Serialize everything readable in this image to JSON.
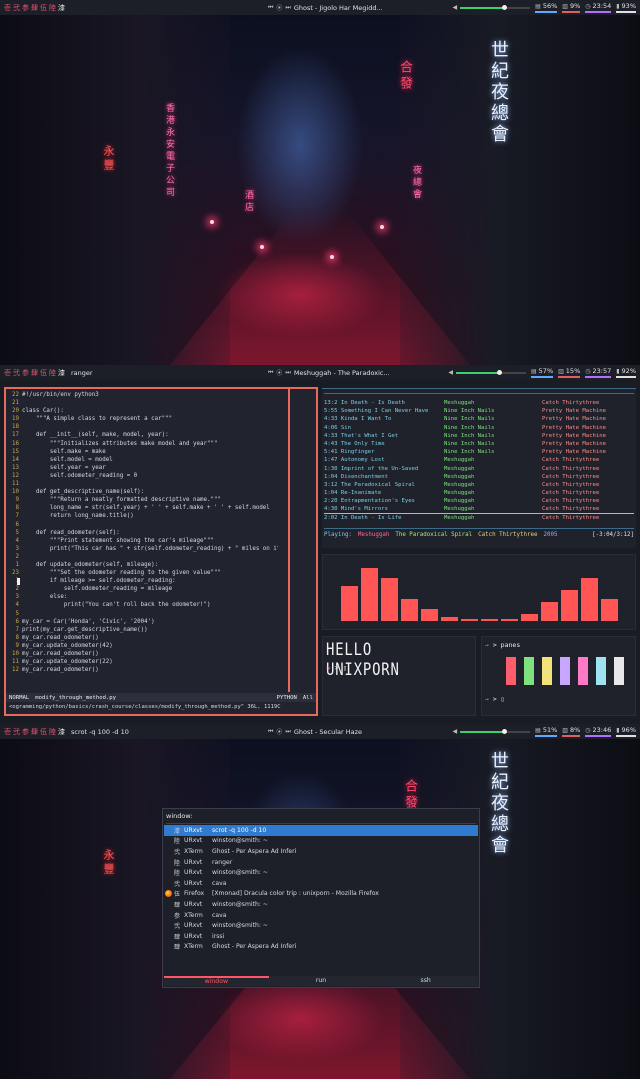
{
  "bars": [
    {
      "workspaces": [
        "壱",
        "弐",
        "参",
        "肆",
        "伍",
        "陸",
        "漆"
      ],
      "active_ws": 6,
      "title": "",
      "song": "Ghost - Jigolo Har Megidd...",
      "cpu": "56%",
      "mem": "9%",
      "time": "23:54",
      "battery": "93%",
      "vol": 0.62
    },
    {
      "workspaces": [
        "壱",
        "弐",
        "参",
        "肆",
        "伍",
        "陸",
        "漆"
      ],
      "active_ws": 6,
      "title": "ranger",
      "song": "Meshuggah - The Paradoxic...",
      "cpu": "57%",
      "mem": "15%",
      "time": "23:57",
      "battery": "92%",
      "vol": 0.62
    },
    {
      "workspaces": [
        "壱",
        "弐",
        "参",
        "肆",
        "伍",
        "陸",
        "漆"
      ],
      "active_ws": 6,
      "title": "scrot -q 100 -d 10",
      "song": "Ghost - Secular Haze",
      "cpu": "51%",
      "mem": "8%",
      "time": "23:46",
      "battery": "96%",
      "vol": 0.62
    }
  ],
  "wallpaper": {
    "sign_left": "香港永安電子公司",
    "sign_right_white": "世紀夜總會",
    "sign_right_red": "合發",
    "sign_left_small": "永豐",
    "sign_mid": "酒店",
    "sign_pink": "夜總會"
  },
  "editor": {
    "lines": [
      {
        "n": "22",
        "t": "#!/usr/bin/env python3"
      },
      {
        "n": "21",
        "t": ""
      },
      {
        "n": "20",
        "t": "class Car():"
      },
      {
        "n": "19",
        "t": "    \"\"\"A simple class to represent a car\"\"\""
      },
      {
        "n": "18",
        "t": ""
      },
      {
        "n": "17",
        "t": "    def __init__(self, make, model, year):"
      },
      {
        "n": "16",
        "t": "        \"\"\"Initializes attributes make model and year\"\"\""
      },
      {
        "n": "15",
        "t": "        self.make = make"
      },
      {
        "n": "14",
        "t": "        self.model = model"
      },
      {
        "n": "13",
        "t": "        self.year = year"
      },
      {
        "n": "12",
        "t": "        self.odometer_reading = 0"
      },
      {
        "n": "11",
        "t": ""
      },
      {
        "n": "10",
        "t": "    def get_descriptive_name(self):"
      },
      {
        "n": "9",
        "t": "        \"\"\"Return a neatly formatted descriptive name.\"\"\""
      },
      {
        "n": "8",
        "t": "        long_name = str(self.year) + ' ' + self.make + ' ' + self.model"
      },
      {
        "n": "7",
        "t": "        return long_name.title()"
      },
      {
        "n": "6",
        "t": ""
      },
      {
        "n": "5",
        "t": "    def read_odometer(self):"
      },
      {
        "n": "4",
        "t": "        \"\"\"Print statement showing the car's mileage\"\"\""
      },
      {
        "n": "3",
        "t": "        print(\"This car has \" + str(self.odometer_reading) + \" miles on it.\")"
      },
      {
        "n": "2",
        "t": ""
      },
      {
        "n": "1",
        "t": "    def update_odometer(self, mileage):"
      },
      {
        "n": "23",
        "t": "        \"\"\"Set the odometer reading to the given value\"\"\""
      },
      {
        "n": "1",
        "t": "        if mileage >= self.odometer_reading:"
      },
      {
        "n": "2",
        "t": "            self.odometer_reading = mileage"
      },
      {
        "n": "3",
        "t": "        else:"
      },
      {
        "n": "4",
        "t": "            print(\"You can't roll back the odometer!\")"
      },
      {
        "n": "5",
        "t": ""
      },
      {
        "n": "6",
        "t": "my_car = Car('Honda', 'Civic', '2004')"
      },
      {
        "n": "7",
        "t": "print(my_car.get_descriptive_name())"
      },
      {
        "n": "8",
        "t": "my_car.read_odometer()"
      },
      {
        "n": "9",
        "t": "my_car.update_odometer(42)"
      },
      {
        "n": "10",
        "t": "my_car.read_odometer()"
      },
      {
        "n": "11",
        "t": "my_car.update_odometer(22)"
      },
      {
        "n": "12",
        "t": "my_car.read_odometer()"
      }
    ],
    "mode": "NORMAL",
    "filename": "modify_through_method.py",
    "filetype": "PYTHON",
    "position": "All",
    "cmdline": "<ogramming/python/basics/crash_course/classes/modify_through_method.py\" 36L, 1119C"
  },
  "music": {
    "tracks": [
      {
        "t": "13:2 In Death - Is Death",
        "a": "Meshuggah",
        "al": "Catch Thirtythree"
      },
      {
        "t": "5:55 Something I Can Never Have",
        "a": "Nine Inch Nails",
        "al": "Pretty Hate Machine"
      },
      {
        "t": "4:33 Kinda I Want To",
        "a": "Nine Inch Nails",
        "al": "Pretty Hate Machine"
      },
      {
        "t": "4:06 Sin",
        "a": "Nine Inch Nails",
        "al": "Pretty Hate Machine"
      },
      {
        "t": "4:33 That's What I Get",
        "a": "Nine Inch Nails",
        "al": "Pretty Hate Machine"
      },
      {
        "t": "4:43 The Only Time",
        "a": "Nine Inch Nails",
        "al": "Pretty Hate Machine"
      },
      {
        "t": "5:41 Ringfinger",
        "a": "Nine Inch Nails",
        "al": "Pretty Hate Machine"
      },
      {
        "t": "1:47 Autonomy Lost",
        "a": "Meshuggah",
        "al": "Catch Thirtythree"
      },
      {
        "t": "1:30 Imprint of the Un-Saved",
        "a": "Meshuggah",
        "al": "Catch Thirtythree"
      },
      {
        "t": "1:04 Disenchantment",
        "a": "Meshuggah",
        "al": "Catch Thirtythree"
      },
      {
        "t": "3:12 The Paradoxical Spiral",
        "a": "Meshuggah",
        "al": "Catch Thirtythree"
      },
      {
        "t": "1:04 Re-Inanimate",
        "a": "Meshuggah",
        "al": "Catch Thirtythree"
      },
      {
        "t": "2:20 Entrapmentation's Eyes",
        "a": "Meshuggah",
        "al": "Catch Thirtythree"
      },
      {
        "t": "4:30 Mind's Mirrors",
        "a": "Meshuggah",
        "al": "Catch Thirtythree"
      },
      {
        "t": "2:02 In Death - Is Life",
        "a": "Meshuggah",
        "al": "Catch Thirtythree"
      }
    ],
    "selected": 13,
    "now_playing": {
      "label": "Playing:",
      "artist": "Meshuggah",
      "song": "The Paradoxical Spiral",
      "album": "Catch Thirtythree",
      "year": "2005",
      "time": "[-3:04/3:12]"
    }
  },
  "visualizer": {
    "levels": [
      0.58,
      0.88,
      0.72,
      0.36,
      0.2,
      0.06,
      0.04,
      0.04,
      0.04,
      0.12,
      0.32,
      0.52,
      0.72,
      0.36
    ],
    "color": "#ff5555"
  },
  "hello": {
    "heading": "HELLO UNIXPORN",
    "prompt_arrow": "→",
    "prompt": "> ▯"
  },
  "panes": {
    "cmd_arrow": "→",
    "cmd": "> panes",
    "prompt": "> ▯",
    "colors": [
      "#ff5c6c",
      "#7ee07e",
      "#f2e27a",
      "#c7a6ff",
      "#ff79c6",
      "#9fe3f0",
      "#e8e8e8"
    ]
  },
  "launcher": {
    "prompt": "window:",
    "items": [
      {
        "g": "漆",
        "cls": "URxvt",
        "title": "scrot -q 100 -d 10"
      },
      {
        "g": "陸",
        "cls": "URxvt",
        "title": "winston@smith: ~"
      },
      {
        "g": "弐",
        "cls": "XTerm",
        "title": "Ghost - Per Aspera Ad Inferi"
      },
      {
        "g": "陸",
        "cls": "URxvt",
        "title": "ranger"
      },
      {
        "g": "陸",
        "cls": "URxvt",
        "title": "winston@smith: ~"
      },
      {
        "g": "弐",
        "cls": "URxvt",
        "title": "cava"
      },
      {
        "g": "伍",
        "cls": "Firefox",
        "title": "[Xmonad] Dracula color trip : unixporn - Mozilla Firefox"
      },
      {
        "g": "肆",
        "cls": "URxvt",
        "title": "winston@smith: ~"
      },
      {
        "g": "参",
        "cls": "XTerm",
        "title": "cava"
      },
      {
        "g": "弐",
        "cls": "URxvt",
        "title": "winston@smith: ~"
      },
      {
        "g": "肆",
        "cls": "URxvt",
        "title": "irssi"
      },
      {
        "g": "肆",
        "cls": "XTerm",
        "title": "Ghost - Per Aspera Ad Inferi"
      }
    ],
    "selected": 0,
    "modes": [
      "window",
      "run",
      "ssh"
    ],
    "active_mode": 0
  }
}
